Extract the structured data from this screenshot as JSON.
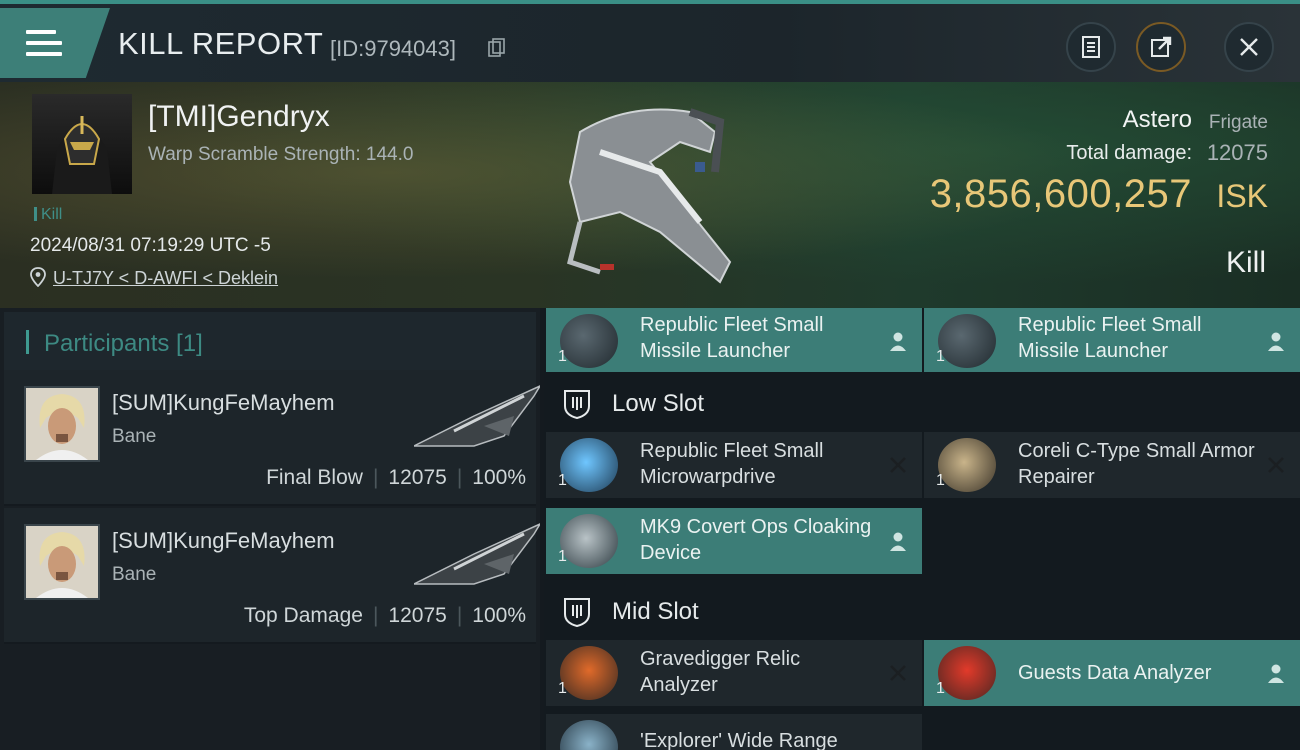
{
  "header": {
    "title": "KILL REPORT",
    "report_id": "[ID:9794043]"
  },
  "victim": {
    "name": "[TMI]Gendryx",
    "subtitle": "Warp Scramble Strength: 144.0",
    "tag": "Kill",
    "datetime": "2024/08/31 07:19:29 UTC -5",
    "location": "U-TJ7Y < D-AWFI < Deklein",
    "ship_name": "Astero",
    "ship_class": "Frigate",
    "total_damage_label": "Total damage:",
    "total_damage": "12075",
    "isk_value": "3,856,600,257",
    "isk_unit": "ISK",
    "result": "Kill"
  },
  "participants": {
    "title": "Participants [1]",
    "rows": [
      {
        "name": "[SUM]KungFeMayhem",
        "ship": "Bane",
        "role": "Final Blow",
        "damage": "12075",
        "percent": "100%"
      },
      {
        "name": "[SUM]KungFeMayhem",
        "ship": "Bane",
        "role": "Top Damage",
        "damage": "12075",
        "percent": "100%"
      }
    ]
  },
  "fitting": {
    "high_slot": [
      {
        "name": "Republic Fleet Small Missile Launcher",
        "qty": "1",
        "state": "dropped"
      },
      {
        "name": "Republic Fleet Small Missile Launcher",
        "qty": "1",
        "state": "dropped"
      }
    ],
    "low_slot_label": "Low Slot",
    "low_slot": [
      {
        "name": "Republic Fleet Small Microwarpdrive",
        "qty": "1",
        "state": "destroyed"
      },
      {
        "name": "Coreli C-Type Small Armor Repairer",
        "qty": "1",
        "state": "destroyed"
      },
      {
        "name": "MK9 Covert Ops Cloaking Device",
        "qty": "1",
        "state": "dropped"
      }
    ],
    "mid_slot_label": "Mid Slot",
    "mid_slot": [
      {
        "name": "Gravedigger Relic Analyzer",
        "qty": "1",
        "state": "destroyed"
      },
      {
        "name": "Guests Data Analyzer",
        "qty": "1",
        "state": "dropped"
      },
      {
        "name": "'Explorer' Wide Range",
        "qty": "",
        "state": "destroyed"
      }
    ]
  },
  "colors": {
    "accent_teal": "#3c7d77",
    "isk_gold": "#e8c778",
    "background": "#141a1f"
  },
  "icons": [
    "menu-icon",
    "copy-icon",
    "clipboard-icon",
    "share-icon",
    "close-icon",
    "location-pin-icon",
    "shield-slot-icon",
    "person-icon",
    "x-icon"
  ]
}
